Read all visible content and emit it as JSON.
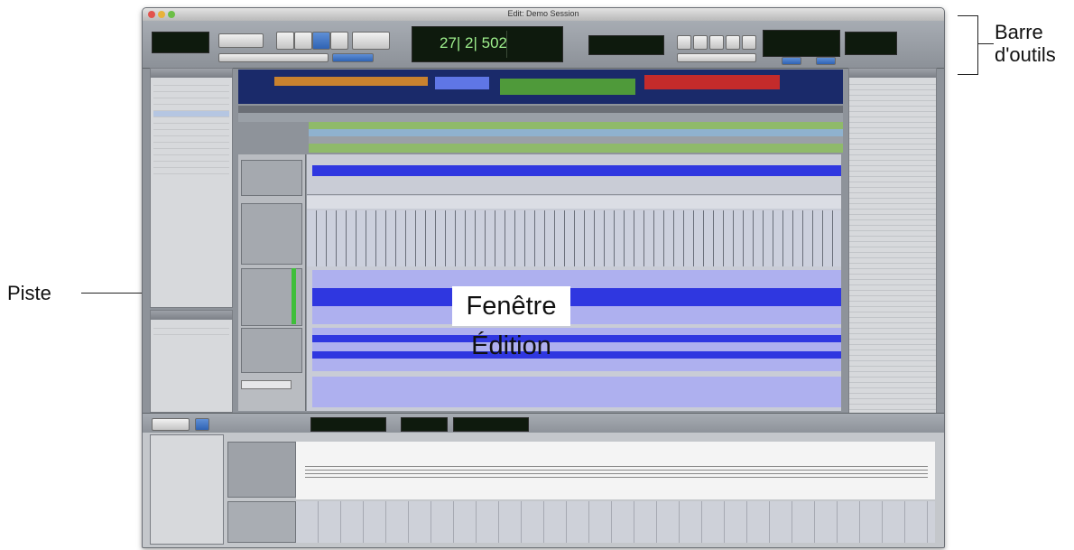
{
  "annotations": {
    "toolbar_label": "Barre\nd'outils",
    "track_label": "Piste",
    "edit_window_label": "Fenêtre Édition"
  },
  "window": {
    "title": "Edit: Demo Session",
    "counter_main": "27| 2| 502",
    "colors": {
      "accent_blue": "#2f37e0",
      "lcd_green": "#7fe26b",
      "region_orange": "#c9822f",
      "region_green": "#4f9a3a",
      "region_red": "#c42b2b"
    }
  },
  "icons": [
    "close-icon",
    "minimize-icon",
    "zoom-icon",
    "play-icon",
    "stop-icon",
    "record-icon",
    "rewind-icon",
    "forward-icon"
  ]
}
